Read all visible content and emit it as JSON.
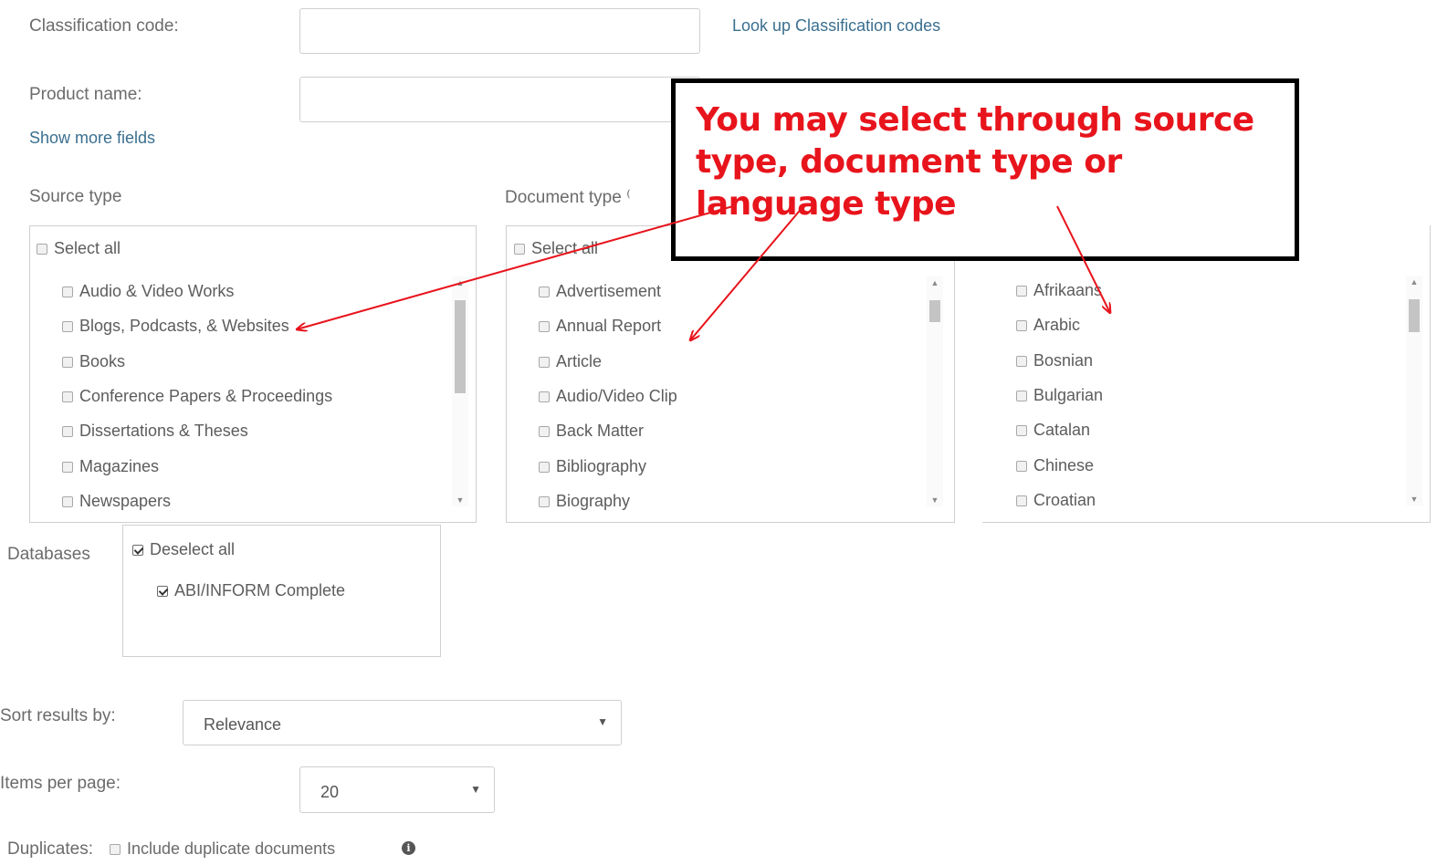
{
  "fields": {
    "classification_label": "Classification code:",
    "classification_value": "",
    "lookup_link": "Look up Classification codes",
    "product_label": "Product name:",
    "product_value": "",
    "show_more": "Show more fields"
  },
  "source_type": {
    "label": "Source type",
    "select_all": "Select all",
    "items": [
      "Audio & Video Works",
      "Blogs, Podcasts, & Websites",
      "Books",
      "Conference Papers & Proceedings",
      "Dissertations & Theses",
      "Magazines",
      "Newspapers"
    ]
  },
  "document_type": {
    "label": "Document type",
    "select_all": "Select all",
    "items": [
      "Advertisement",
      "Annual Report",
      "Article",
      "Audio/Video Clip",
      "Back Matter",
      "Bibliography",
      "Biography"
    ]
  },
  "language": {
    "items": [
      "Afrikaans",
      "Arabic",
      "Bosnian",
      "Bulgarian",
      "Catalan",
      "Chinese",
      "Croatian"
    ]
  },
  "databases": {
    "label": "Databases",
    "deselect_all": "Deselect all",
    "items": [
      "ABI/INFORM Complete"
    ]
  },
  "sort": {
    "label": "Sort results by:",
    "value": "Relevance"
  },
  "items_per_page": {
    "label": "Items per page:",
    "value": "20"
  },
  "duplicates": {
    "label": "Duplicates:",
    "option": "Include duplicate documents"
  },
  "callout": {
    "text": "You may select through source type, document type or language type",
    "text_color": "#e8141c",
    "border_color": "#000000"
  },
  "icons": {
    "info": "info-icon",
    "dropdown": "chevron-down-icon"
  }
}
